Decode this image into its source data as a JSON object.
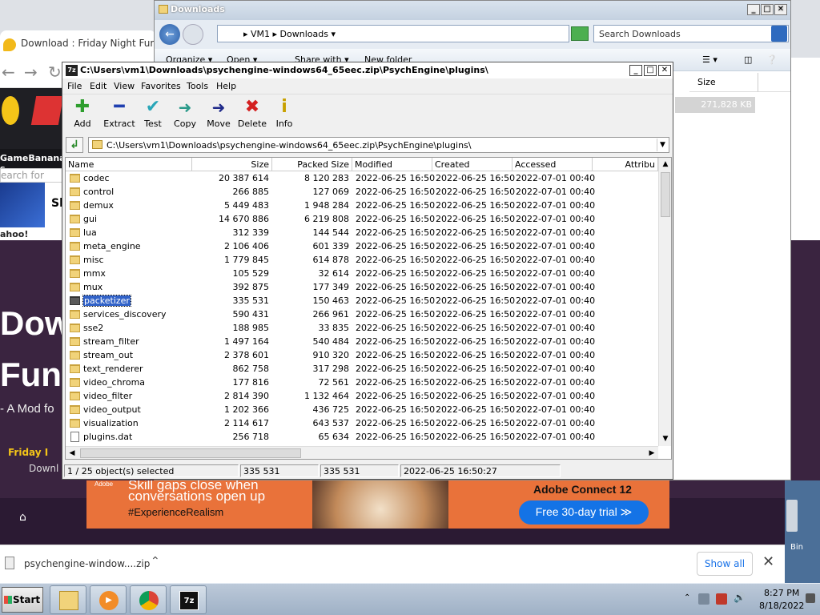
{
  "browser": {
    "tab_title": "Download : Friday Night Funkin' -",
    "site_name": "GameBanana s",
    "search_placeholder": "earch for",
    "sl_text": "Sl",
    "yahoo_text": "ahoo! Search l",
    "hero_title1": "Dow",
    "hero_title2": "Fun",
    "hero_subtitle": "- A Mod fo",
    "hero_friday": "Friday I",
    "hero_download": "Downl",
    "ad": {
      "adobe_tag": "Adobe",
      "line1": "Skill gaps close when",
      "line2": "conversations open up",
      "hashtag": "#ExperienceRealism",
      "brand": "Adobe Connect 12",
      "cta": "Free 30-day trial ≫"
    },
    "downloads": {
      "file_name": "psychengine-window....zip",
      "show_all": "Show all"
    }
  },
  "desktop": {
    "recycle_label": "Bin"
  },
  "explorer": {
    "title": "Downloads",
    "address": "▸  VM1 ▸ Downloads ▾",
    "search_placeholder": "Search Downloads",
    "toolbar": [
      "Organize ▾",
      "Open ▾",
      "Share with ▾",
      "New folder"
    ],
    "col_size": "Size",
    "selected_size": "271,828 KB"
  },
  "sevenzip": {
    "title": "C:\\Users\\vm1\\Downloads\\psychengine-windows64_65eec.zip\\PsychEngine\\plugins\\",
    "menu": [
      "File",
      "Edit",
      "View",
      "Favorites",
      "Tools",
      "Help"
    ],
    "toolbar": [
      {
        "label": "Add",
        "icon": "add-icon",
        "glyph": "✚",
        "color": "#2e9e2e"
      },
      {
        "label": "Extract",
        "icon": "extract-icon",
        "glyph": "━",
        "color": "#1f3fb0"
      },
      {
        "label": "Test",
        "icon": "test-icon",
        "glyph": "✔",
        "color": "#2aa6b8"
      },
      {
        "label": "Copy",
        "icon": "copy-icon",
        "glyph": "➜",
        "color": "#2a9a8a"
      },
      {
        "label": "Move",
        "icon": "move-icon",
        "glyph": "➜",
        "color": "#1f2a8a"
      },
      {
        "label": "Delete",
        "icon": "delete-icon",
        "glyph": "✖",
        "color": "#d42020"
      },
      {
        "label": "Info",
        "icon": "info-icon",
        "glyph": "i",
        "color": "#c8a000"
      }
    ],
    "path": "C:\\Users\\vm1\\Downloads\\psychengine-windows64_65eec.zip\\PsychEngine\\plugins\\",
    "columns": [
      "Name",
      "Size",
      "Packed Size",
      "Modified",
      "Created",
      "Accessed",
      "Attribu"
    ],
    "rows": [
      {
        "name": "codec",
        "size": "20 387 614",
        "packed": "8 120 283",
        "modified": "2022-06-25 16:50",
        "created": "2022-06-25 16:50",
        "accessed": "2022-07-01 00:40",
        "type": "folder"
      },
      {
        "name": "control",
        "size": "266 885",
        "packed": "127 069",
        "modified": "2022-06-25 16:50",
        "created": "2022-06-25 16:50",
        "accessed": "2022-07-01 00:40",
        "type": "folder"
      },
      {
        "name": "demux",
        "size": "5 449 483",
        "packed": "1 948 284",
        "modified": "2022-06-25 16:50",
        "created": "2022-06-25 16:50",
        "accessed": "2022-07-01 00:40",
        "type": "folder"
      },
      {
        "name": "gui",
        "size": "14 670 886",
        "packed": "6 219 808",
        "modified": "2022-06-25 16:50",
        "created": "2022-06-25 16:50",
        "accessed": "2022-07-01 00:40",
        "type": "folder"
      },
      {
        "name": "lua",
        "size": "312 339",
        "packed": "144 544",
        "modified": "2022-06-25 16:50",
        "created": "2022-06-25 16:50",
        "accessed": "2022-07-01 00:40",
        "type": "folder"
      },
      {
        "name": "meta_engine",
        "size": "2 106 406",
        "packed": "601 339",
        "modified": "2022-06-25 16:50",
        "created": "2022-06-25 16:50",
        "accessed": "2022-07-01 00:40",
        "type": "folder"
      },
      {
        "name": "misc",
        "size": "1 779 845",
        "packed": "614 878",
        "modified": "2022-06-25 16:50",
        "created": "2022-06-25 16:50",
        "accessed": "2022-07-01 00:40",
        "type": "folder"
      },
      {
        "name": "mmx",
        "size": "105 529",
        "packed": "32 614",
        "modified": "2022-06-25 16:50",
        "created": "2022-06-25 16:50",
        "accessed": "2022-07-01 00:40",
        "type": "folder"
      },
      {
        "name": "mux",
        "size": "392 875",
        "packed": "177 349",
        "modified": "2022-06-25 16:50",
        "created": "2022-06-25 16:50",
        "accessed": "2022-07-01 00:40",
        "type": "folder"
      },
      {
        "name": "packetizer",
        "size": "335 531",
        "packed": "150 463",
        "modified": "2022-06-25 16:50",
        "created": "2022-06-25 16:50",
        "accessed": "2022-07-01 00:40",
        "type": "folder-selected"
      },
      {
        "name": "services_discovery",
        "size": "590 431",
        "packed": "266 961",
        "modified": "2022-06-25 16:50",
        "created": "2022-06-25 16:50",
        "accessed": "2022-07-01 00:40",
        "type": "folder"
      },
      {
        "name": "sse2",
        "size": "188 985",
        "packed": "33 835",
        "modified": "2022-06-25 16:50",
        "created": "2022-06-25 16:50",
        "accessed": "2022-07-01 00:40",
        "type": "folder"
      },
      {
        "name": "stream_filter",
        "size": "1 497 164",
        "packed": "540 484",
        "modified": "2022-06-25 16:50",
        "created": "2022-06-25 16:50",
        "accessed": "2022-07-01 00:40",
        "type": "folder"
      },
      {
        "name": "stream_out",
        "size": "2 378 601",
        "packed": "910 320",
        "modified": "2022-06-25 16:50",
        "created": "2022-06-25 16:50",
        "accessed": "2022-07-01 00:40",
        "type": "folder"
      },
      {
        "name": "text_renderer",
        "size": "862 758",
        "packed": "317 298",
        "modified": "2022-06-25 16:50",
        "created": "2022-06-25 16:50",
        "accessed": "2022-07-01 00:40",
        "type": "folder"
      },
      {
        "name": "video_chroma",
        "size": "177 816",
        "packed": "72 561",
        "modified": "2022-06-25 16:50",
        "created": "2022-06-25 16:50",
        "accessed": "2022-07-01 00:40",
        "type": "folder"
      },
      {
        "name": "video_filter",
        "size": "2 814 390",
        "packed": "1 132 464",
        "modified": "2022-06-25 16:50",
        "created": "2022-06-25 16:50",
        "accessed": "2022-07-01 00:40",
        "type": "folder"
      },
      {
        "name": "video_output",
        "size": "1 202 366",
        "packed": "436 725",
        "modified": "2022-06-25 16:50",
        "created": "2022-06-25 16:50",
        "accessed": "2022-07-01 00:40",
        "type": "folder"
      },
      {
        "name": "visualization",
        "size": "2 114 617",
        "packed": "643 537",
        "modified": "2022-06-25 16:50",
        "created": "2022-06-25 16:50",
        "accessed": "2022-07-01 00:40",
        "type": "folder"
      },
      {
        "name": "plugins.dat",
        "size": "256 718",
        "packed": "65 634",
        "modified": "2022-06-25 16:50",
        "created": "2022-06-25 16:50",
        "accessed": "2022-07-01 00:40",
        "type": "file"
      }
    ],
    "status": {
      "selection": "1 / 25 object(s) selected",
      "size": "335 531",
      "packed": "335 531",
      "modified": "2022-06-25 16:50:27"
    }
  },
  "taskbar": {
    "start": "Start",
    "apps": [
      "explorer-icon",
      "media-player-icon",
      "chrome-icon",
      "7zip-icon"
    ],
    "sevenzip_label": "7z",
    "time": "8:27 PM",
    "date": "8/18/2022"
  }
}
